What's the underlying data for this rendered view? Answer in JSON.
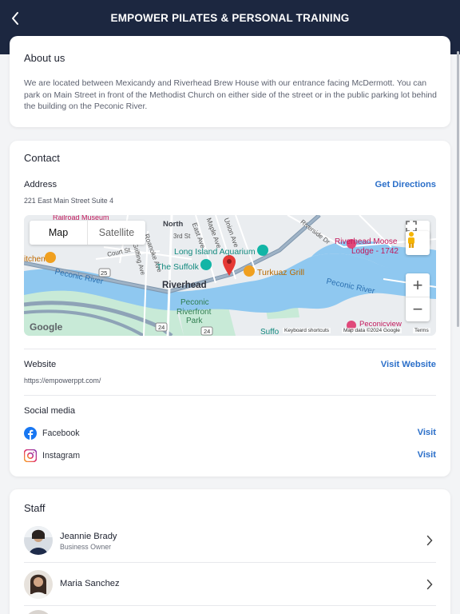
{
  "header": {
    "title": "EMPOWER PILATES & PERSONAL TRAINING"
  },
  "about": {
    "heading": "About us",
    "text": "We are located between Mexicandy and Riverhead Brew House with our entrance facing McDermott.  You can park on Main Street in front of the Methodist Church on either side of the street or in the public parking lot behind the building on the Peconic River."
  },
  "contact": {
    "heading": "Contact",
    "address_label": "Address",
    "address_value": "221 East Main Street Suite 4",
    "directions_label": "Get Directions",
    "website_label": "Website",
    "website_value": "https://empowerppt.com/",
    "visit_website_label": "Visit Website",
    "social_label": "Social media",
    "social": [
      {
        "name": "Facebook",
        "action": "Visit",
        "icon": "facebook-icon"
      },
      {
        "name": "Instagram",
        "action": "Visit",
        "icon": "instagram-icon"
      }
    ]
  },
  "map": {
    "toggle_map": "Map",
    "toggle_satellite": "Satellite",
    "labels": {
      "railroad_museum": "Railroad Museum",
      "north": "North",
      "roanoke_ave": "Roanoke Ave",
      "third_st": "3rd St",
      "east_ave": "East Ave",
      "maple_ave": "Maple Ave",
      "union_ave": "Union Ave",
      "riverside_dr": "Riverside Dr",
      "riverhead_moose": "Riverhead Moose",
      "lodge": "Lodge - 1742",
      "kitchen": "itchen",
      "court_st": "Court St",
      "griffing_ave": "Griffing Ave",
      "long_island_aquarium": "Long Island Aquarium",
      "the_suffolk": "The Suffolk",
      "turkuaz_grill": "Turkuaz Grill",
      "peconic_river_w": "Peconic River",
      "peconic_river_e": "Peconic River",
      "riverhead": "Riverhead",
      "riverfront_park_1": "Peconic",
      "riverfront_park_2": "Riverfront",
      "riverfront_park_3": "Park",
      "route_25": "25",
      "route_24a": "24",
      "route_24b": "24",
      "suffolk": "Suffo",
      "peconicview": "Peconicview",
      "google": "Google",
      "keyboard_shortcuts": "Keyboard shortcuts",
      "map_data": "Map data ©2024 Google",
      "terms": "Terms"
    },
    "zoom_in": "+",
    "zoom_out": "−"
  },
  "staff": {
    "heading": "Staff",
    "members": [
      {
        "name": "Jeannie Brady",
        "role": "Business Owner"
      },
      {
        "name": "Maria Sanchez",
        "role": ""
      }
    ]
  },
  "colors": {
    "header_bg": "#1c2740",
    "link": "#2b6fc9",
    "water": "#8fc8f0",
    "park": "#c5e8d4"
  }
}
